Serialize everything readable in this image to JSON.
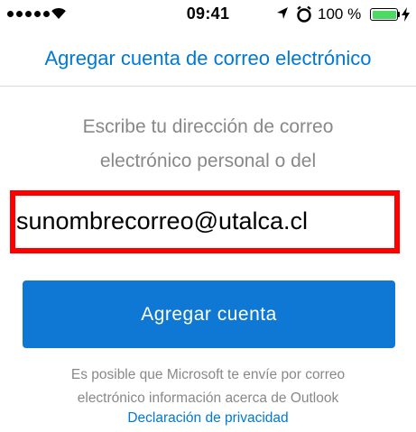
{
  "status_bar": {
    "time": "09:41",
    "battery_percent_label": "100 %",
    "battery_level": 1.0,
    "battery_color": "#4cd964",
    "icons": [
      "signal-dots-icon",
      "wifi-icon",
      "location-arrow-icon",
      "alarm-icon",
      "battery-icon",
      "charging-bolt-icon"
    ]
  },
  "header": {
    "title": "Agregar cuenta de correo electrónico"
  },
  "form": {
    "instructions_line1": "Escribe tu dirección de correo",
    "instructions_line2": "electrónico personal o del",
    "email_value": "sunombrecorreo@utalca.cl",
    "highlight_color": "#ff0000",
    "submit_label": "Agregar cuenta"
  },
  "footer": {
    "disclaimer_line1": "Es posible que Microsoft te envíe por correo",
    "disclaimer_line2": "electrónico información acerca de Outlook",
    "privacy_link": "Declaración de privacidad"
  },
  "colors": {
    "accent": "#0078d4",
    "button": "#0f78d4",
    "muted_text": "#888888"
  }
}
